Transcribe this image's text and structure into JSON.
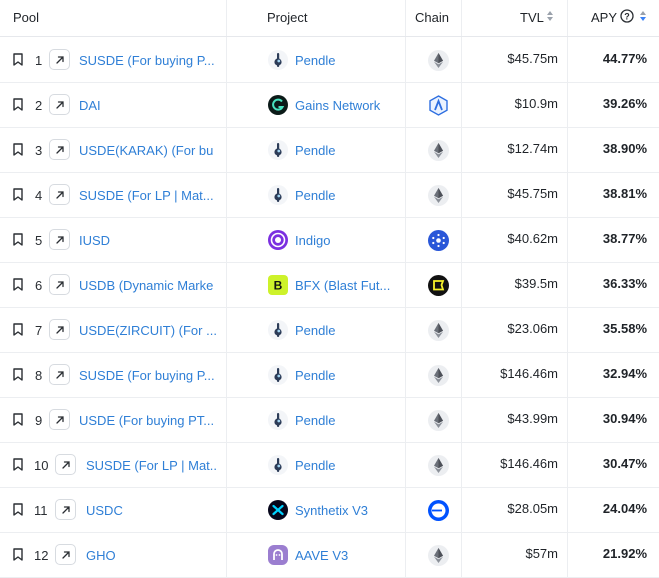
{
  "header": {
    "pool": "Pool",
    "project": "Project",
    "chain": "Chain",
    "tvl": "TVL",
    "apy": "APY"
  },
  "rows": [
    {
      "rank": "1",
      "pool": "SUSDE (For buying P...",
      "project": "Pendle",
      "project_logo": "pendle",
      "chain": "ethereum",
      "tvl": "$45.75m",
      "apy": "44.77%"
    },
    {
      "rank": "2",
      "pool": "DAI",
      "project": "Gains Network",
      "project_logo": "gains",
      "chain": "arbitrum",
      "tvl": "$10.9m",
      "apy": "39.26%"
    },
    {
      "rank": "3",
      "pool": "USDE(KARAK) (For bu",
      "project": "Pendle",
      "project_logo": "pendle",
      "chain": "ethereum",
      "tvl": "$12.74m",
      "apy": "38.90%"
    },
    {
      "rank": "4",
      "pool": "SUSDE (For LP | Mat...",
      "project": "Pendle",
      "project_logo": "pendle",
      "chain": "ethereum",
      "tvl": "$45.75m",
      "apy": "38.81%"
    },
    {
      "rank": "5",
      "pool": "IUSD",
      "project": "Indigo",
      "project_logo": "indigo",
      "chain": "cardano",
      "tvl": "$40.62m",
      "apy": "38.77%"
    },
    {
      "rank": "6",
      "pool": "USDB (Dynamic Marke",
      "project": "BFX (Blast Fut...",
      "project_logo": "bfx",
      "chain": "blast",
      "tvl": "$39.5m",
      "apy": "36.33%"
    },
    {
      "rank": "7",
      "pool": "USDE(ZIRCUIT) (For ...",
      "project": "Pendle",
      "project_logo": "pendle",
      "chain": "ethereum",
      "tvl": "$23.06m",
      "apy": "35.58%"
    },
    {
      "rank": "8",
      "pool": "SUSDE (For buying P...",
      "project": "Pendle",
      "project_logo": "pendle",
      "chain": "ethereum",
      "tvl": "$146.46m",
      "apy": "32.94%"
    },
    {
      "rank": "9",
      "pool": "USDE (For buying PT...",
      "project": "Pendle",
      "project_logo": "pendle",
      "chain": "ethereum",
      "tvl": "$43.99m",
      "apy": "30.94%"
    },
    {
      "rank": "10",
      "pool": "SUSDE (For LP | Mat...",
      "project": "Pendle",
      "project_logo": "pendle",
      "chain": "ethereum",
      "tvl": "$146.46m",
      "apy": "30.47%"
    },
    {
      "rank": "11",
      "pool": "USDC",
      "project": "Synthetix V3",
      "project_logo": "synthetix",
      "chain": "base",
      "tvl": "$28.05m",
      "apy": "24.04%"
    },
    {
      "rank": "12",
      "pool": "GHO",
      "project": "AAVE V3",
      "project_logo": "aave",
      "chain": "ethereum",
      "tvl": "$57m",
      "apy": "21.92%"
    }
  ],
  "colors": {
    "link": "#2f7fd6",
    "sort_active": "#3b82f6"
  }
}
